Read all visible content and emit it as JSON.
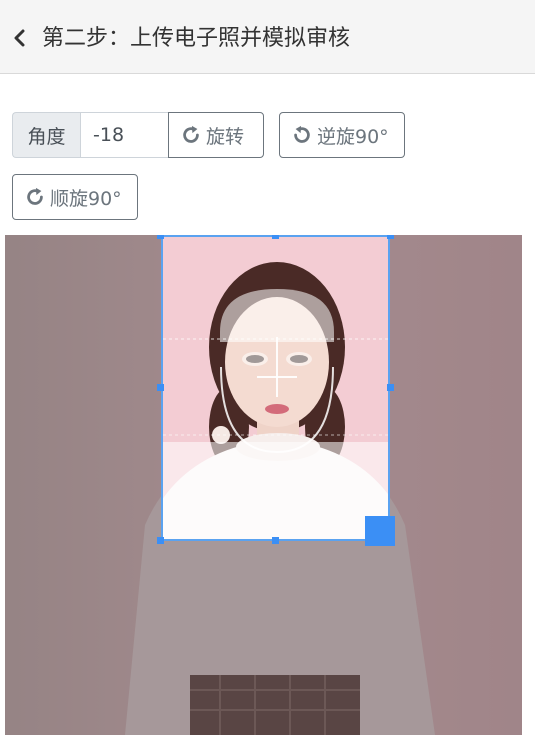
{
  "header": {
    "title": "第二步：上传电子照并模拟审核"
  },
  "controls": {
    "angle_label": "角度",
    "angle_value": "-18",
    "rotate_label": "旋转",
    "rotate_ccw_label": "逆旋90°",
    "rotate_cw_label": "顺旋90°"
  },
  "icons": {
    "back": "chevron-left-icon",
    "rotate": "rotate-right-icon",
    "rotate_ccw": "rotate-left-icon",
    "rotate_cw": "rotate-right-icon"
  },
  "colors": {
    "accent": "#3b8ff5",
    "header_bg": "#f5f5f5",
    "button_border": "#6c757d"
  }
}
